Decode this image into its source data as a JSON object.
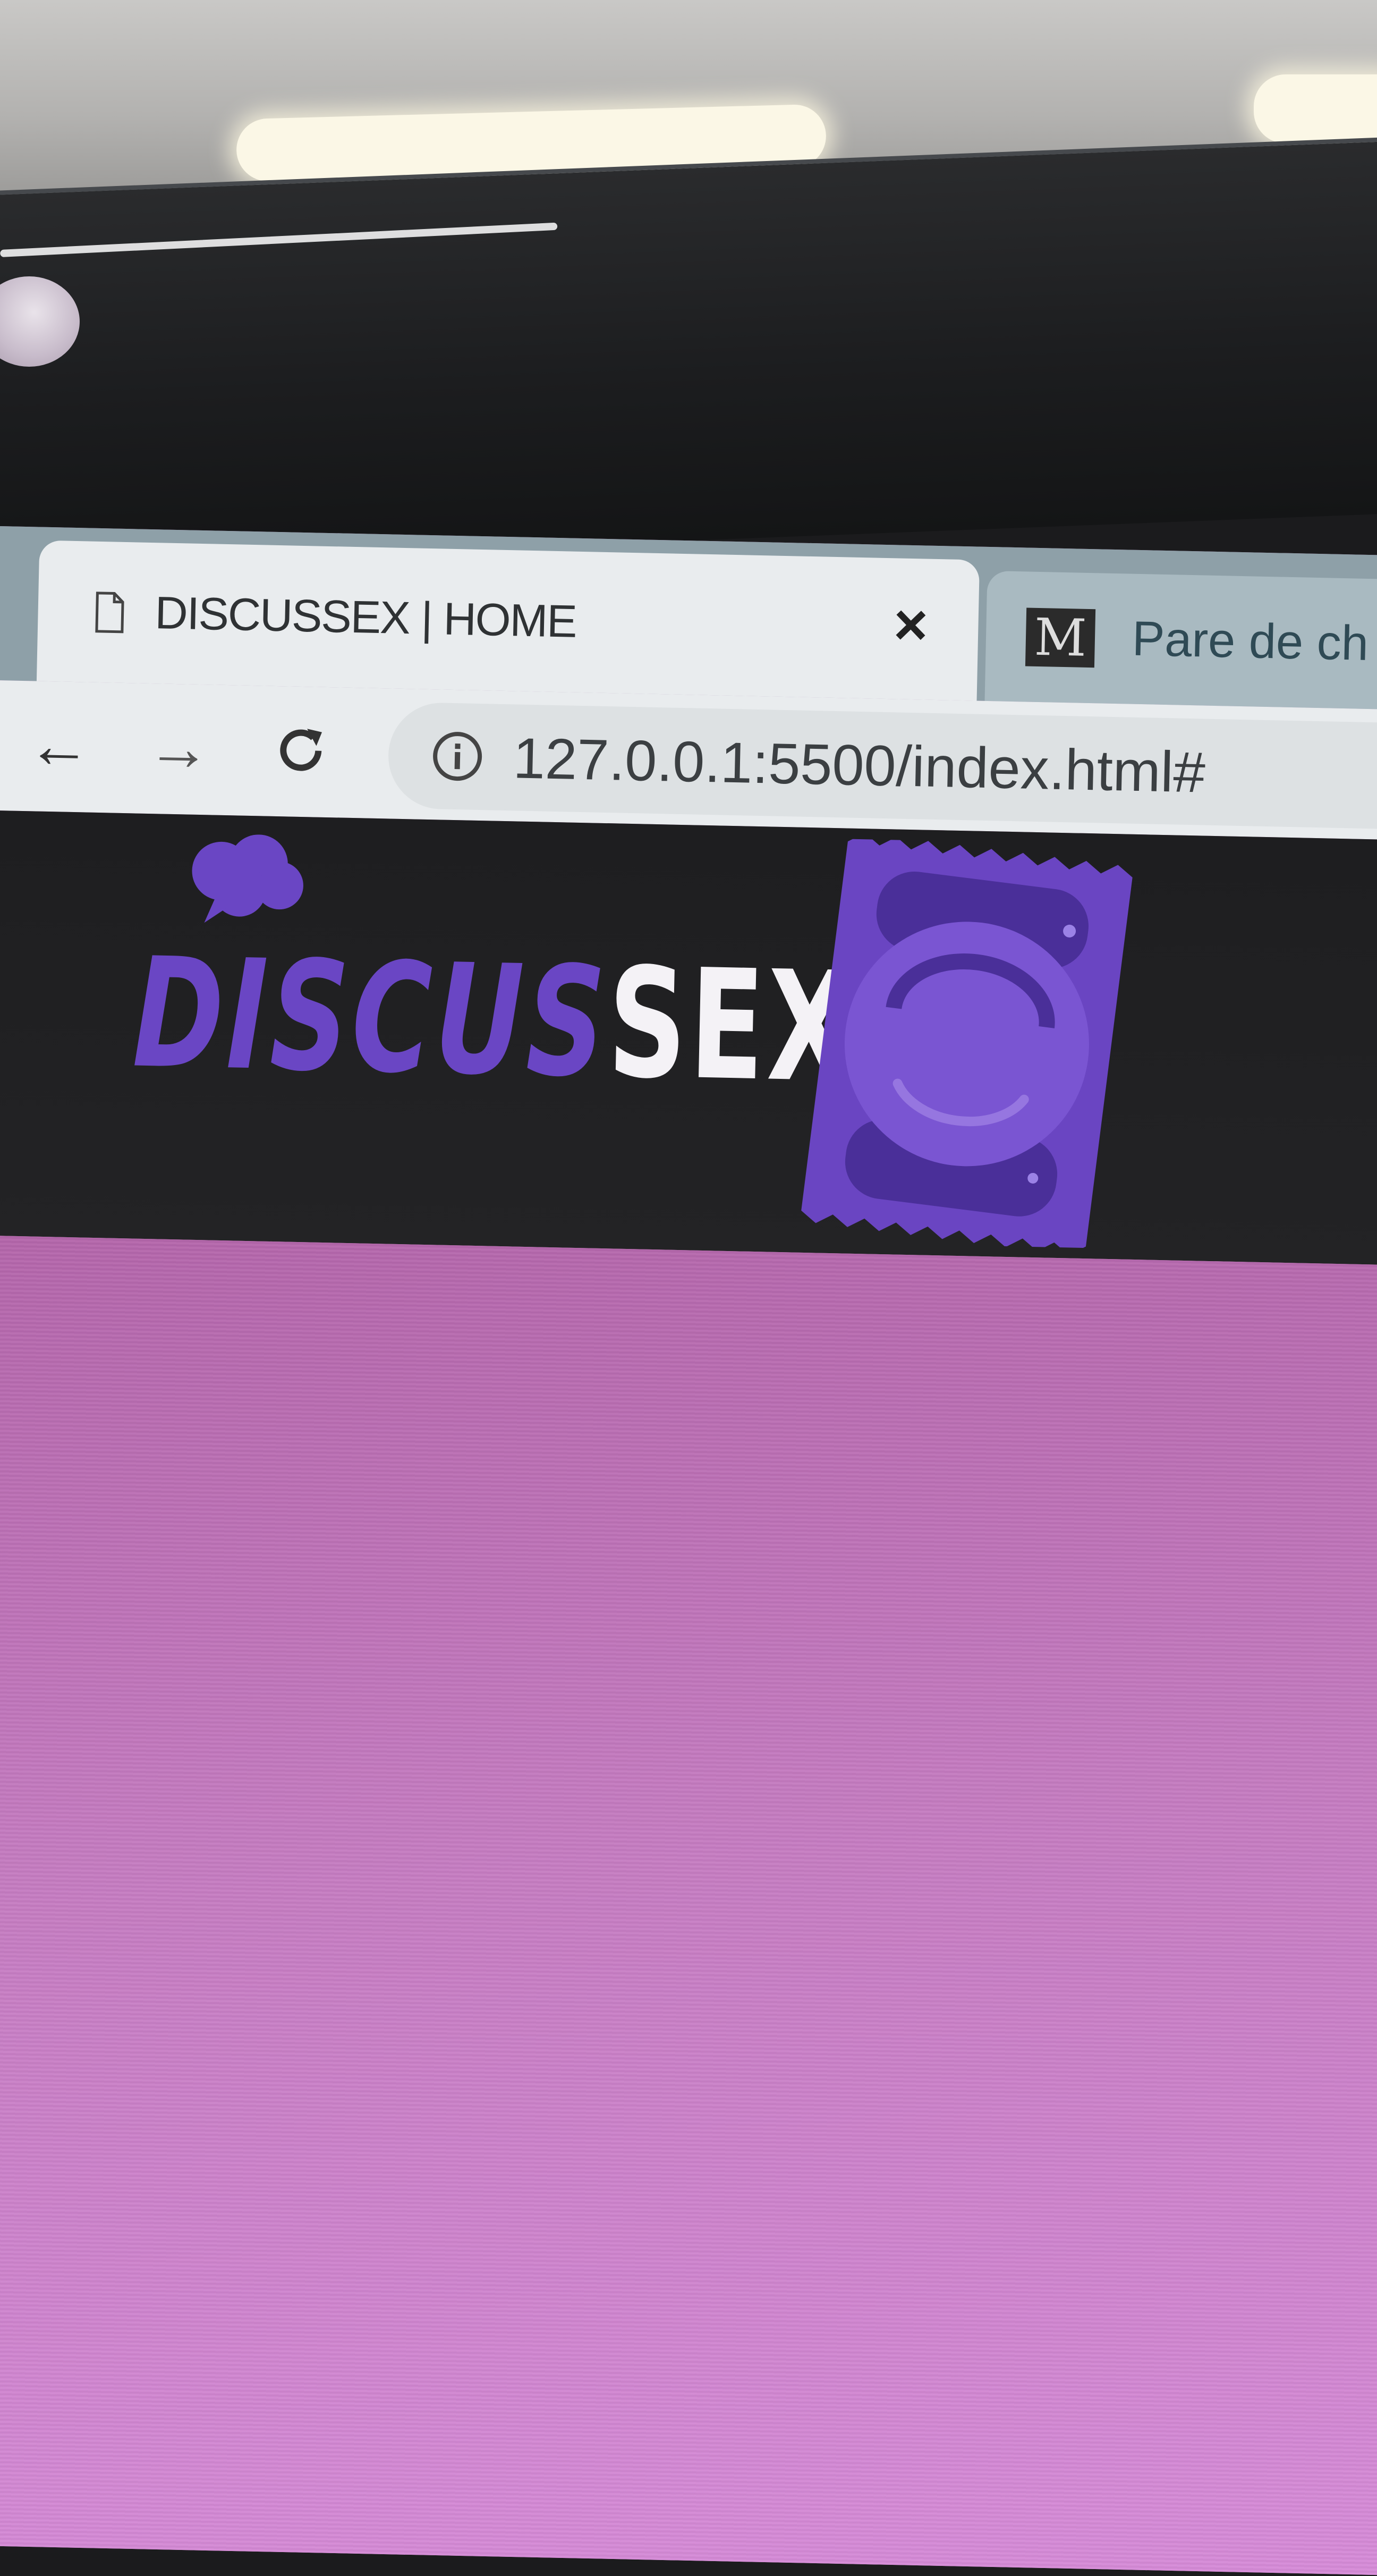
{
  "browser": {
    "active_tab": {
      "title": "DISCUSSEX | HOME",
      "close_glyph": "×",
      "icon": "document-icon"
    },
    "inactive_tab": {
      "favicon_letter": "M",
      "title": "Pare de ch"
    },
    "toolbar": {
      "back_glyph": "←",
      "forward_glyph": "→",
      "reload_glyph": "C",
      "url": "127.0.0.1:5500/index.html#"
    }
  },
  "site": {
    "logo": {
      "part_1": "DISCUS",
      "part_2": "SEX"
    },
    "colors": {
      "brand_purple": "#6a46c4",
      "header_bg": "#1e1e20",
      "body_bg": "#c57cc1"
    }
  }
}
